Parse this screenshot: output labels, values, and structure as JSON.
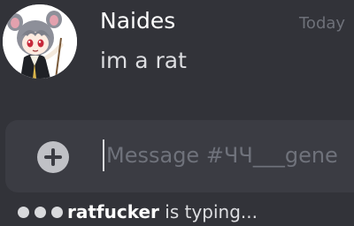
{
  "message": {
    "author": "Naides",
    "timestamp": "Today",
    "content": "im a rat",
    "avatar_icon": "anime-rat-girl-avatar"
  },
  "composer": {
    "add_icon": "plus-circle-icon",
    "placeholder": "Message #ЧЧ___gene"
  },
  "typing": {
    "user": "ratfucker",
    "text": " is typing..."
  },
  "colors": {
    "background": "#323339",
    "composer": "#3b3c43",
    "username": "#ffffff",
    "timestamp": "#6e7179",
    "text": "#dddee1"
  }
}
